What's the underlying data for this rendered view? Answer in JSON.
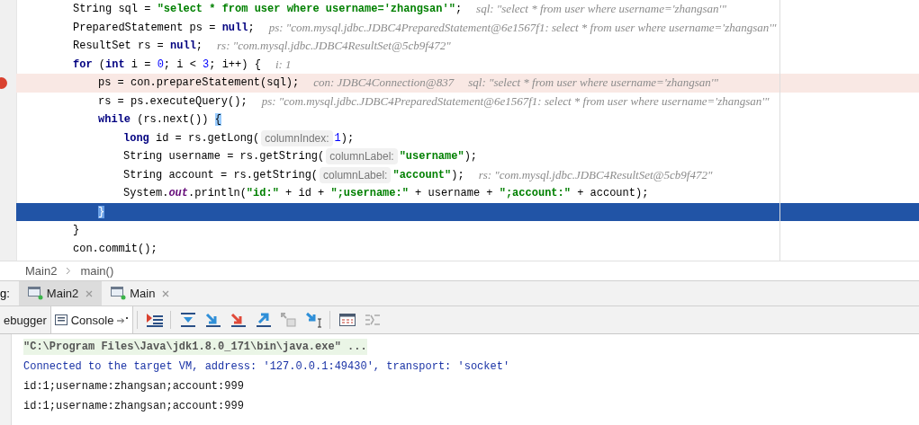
{
  "editor": {
    "lines": [
      {
        "breakpoint": false,
        "execution_point": false,
        "tokens": [
          {
            "kind": "plain",
            "text": "String sql = "
          },
          {
            "kind": "str",
            "text": "\"select * from user where username='zhangsan'\""
          },
          {
            "kind": "plain",
            "text": ";"
          },
          {
            "kind": "val",
            "text": "sql: \"select * from user where username='zhangsan'\""
          }
        ]
      },
      {
        "breakpoint": false,
        "execution_point": false,
        "tokens": [
          {
            "kind": "plain",
            "text": "PreparedStatement ps = "
          },
          {
            "kind": "kw",
            "text": "null"
          },
          {
            "kind": "plain",
            "text": ";"
          },
          {
            "kind": "val",
            "text": "ps: \"com.mysql.jdbc.JDBC4PreparedStatement@6e1567f1: select * from user where username='zhangsan'\""
          }
        ]
      },
      {
        "breakpoint": false,
        "execution_point": false,
        "tokens": [
          {
            "kind": "plain",
            "text": "ResultSet rs = "
          },
          {
            "kind": "kw",
            "text": "null"
          },
          {
            "kind": "plain",
            "text": ";"
          },
          {
            "kind": "val",
            "text": "rs: \"com.mysql.jdbc.JDBC4ResultSet@5cb9f472\""
          }
        ]
      },
      {
        "breakpoint": false,
        "execution_point": false,
        "tokens": [
          {
            "kind": "kw",
            "text": "for"
          },
          {
            "kind": "plain",
            "text": " ("
          },
          {
            "kind": "kw",
            "text": "int"
          },
          {
            "kind": "plain",
            "text": " i = "
          },
          {
            "kind": "num",
            "text": "0"
          },
          {
            "kind": "plain",
            "text": "; i < "
          },
          {
            "kind": "num",
            "text": "3"
          },
          {
            "kind": "plain",
            "text": "; i++) {"
          },
          {
            "kind": "val",
            "text": "i: 1"
          }
        ],
        "children": [
          {
            "breakpoint": true,
            "execution_point": false,
            "tokens": [
              {
                "kind": "plain",
                "text": "ps = con.prepareStatement(sql);"
              },
              {
                "kind": "val",
                "text": "con: JDBC4Connection@837"
              },
              {
                "kind": "val",
                "text": "sql: \"select * from user where username='zhangsan'\""
              }
            ]
          },
          {
            "breakpoint": false,
            "execution_point": false,
            "tokens": [
              {
                "kind": "plain",
                "text": "rs = ps.executeQuery();"
              },
              {
                "kind": "val",
                "text": "ps: \"com.mysql.jdbc.JDBC4PreparedStatement@6e1567f1: select * from user where username='zhangsan'\""
              }
            ]
          },
          {
            "breakpoint": false,
            "execution_point": false,
            "tokens": [
              {
                "kind": "kw",
                "text": "while"
              },
              {
                "kind": "plain",
                "text": " (rs.next()) "
              },
              {
                "kind": "brace",
                "text": "{"
              }
            ],
            "children": [
              {
                "breakpoint": false,
                "execution_point": false,
                "tokens": [
                  {
                    "kind": "kw",
                    "text": "long"
                  },
                  {
                    "kind": "plain",
                    "text": " id = rs.getLong("
                  },
                  {
                    "kind": "hint",
                    "text": "columnIndex:"
                  },
                  {
                    "kind": "num",
                    "text": "1"
                  },
                  {
                    "kind": "plain",
                    "text": ");"
                  }
                ]
              },
              {
                "breakpoint": false,
                "execution_point": false,
                "tokens": [
                  {
                    "kind": "plain",
                    "text": "String username = rs.getString("
                  },
                  {
                    "kind": "hint",
                    "text": "columnLabel:"
                  },
                  {
                    "kind": "str",
                    "text": "\"username\""
                  },
                  {
                    "kind": "plain",
                    "text": ");"
                  }
                ]
              },
              {
                "breakpoint": false,
                "execution_point": false,
                "tokens": [
                  {
                    "kind": "plain",
                    "text": "String account = rs.getString("
                  },
                  {
                    "kind": "hint",
                    "text": "columnLabel:"
                  },
                  {
                    "kind": "str",
                    "text": "\"account\""
                  },
                  {
                    "kind": "plain",
                    "text": ");"
                  },
                  {
                    "kind": "val",
                    "text": "rs: \"com.mysql.jdbc.JDBC4ResultSet@5cb9f472\""
                  }
                ]
              },
              {
                "breakpoint": false,
                "execution_point": false,
                "tokens": [
                  {
                    "kind": "plain",
                    "text": "System."
                  },
                  {
                    "kind": "field",
                    "text": "out"
                  },
                  {
                    "kind": "plain",
                    "text": ".println("
                  },
                  {
                    "kind": "str",
                    "text": "\"id:\""
                  },
                  {
                    "kind": "plain",
                    "text": " + id + "
                  },
                  {
                    "kind": "str",
                    "text": "\";username:\""
                  },
                  {
                    "kind": "plain",
                    "text": " + username + "
                  },
                  {
                    "kind": "str",
                    "text": "\";account:\""
                  },
                  {
                    "kind": "plain",
                    "text": " + account);"
                  }
                ]
              }
            ]
          },
          {
            "breakpoint": false,
            "execution_point": true,
            "tokens": [
              {
                "kind": "brace",
                "text": "}"
              }
            ]
          }
        ]
      },
      {
        "breakpoint": false,
        "execution_point": false,
        "tokens": [
          {
            "kind": "plain",
            "text": "}"
          }
        ]
      },
      {
        "breakpoint": false,
        "execution_point": false,
        "tokens": [
          {
            "kind": "plain",
            "text": "con.commit();"
          }
        ]
      }
    ]
  },
  "breadcrumbs": [
    "Main2",
    "main()"
  ],
  "run_tabs": {
    "label": "g:",
    "tabs": [
      {
        "label": "Main2",
        "selected": true
      },
      {
        "label": "Main",
        "selected": false
      }
    ]
  },
  "tool_tabs": [
    {
      "label": "ebugger",
      "selected": false
    },
    {
      "label": "Console",
      "selected": true
    }
  ],
  "console": [
    {
      "kind": "command",
      "text": "\"C:\\Program Files\\Java\\jdk1.8.0_171\\bin\\java.exe\" ..."
    },
    {
      "kind": "system",
      "text": "Connected to the target VM, address: '127.0.0.1:49430', transport: 'socket'"
    },
    {
      "kind": "output",
      "text": "id:1;username:zhangsan;account:999"
    },
    {
      "kind": "output",
      "text": "id:1;username:zhangsan;account:999"
    }
  ]
}
